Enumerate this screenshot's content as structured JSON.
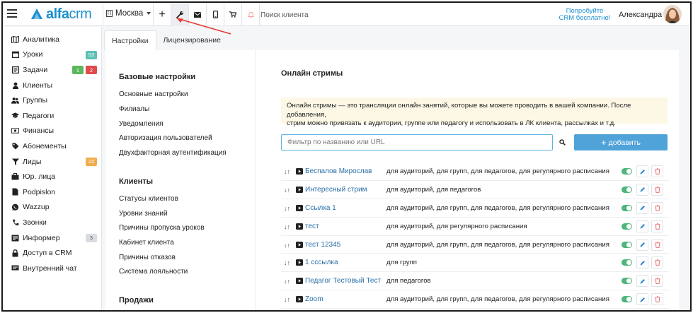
{
  "header": {
    "logo_main": "alfa",
    "logo_sub": "crm",
    "city": "Москва",
    "add_label": "+",
    "search_placeholder": "Поиск клиента",
    "try_line1": "Попробуйте",
    "try_line2": "CRM бесплатно!",
    "username": "Александра"
  },
  "sidebar": {
    "items": [
      {
        "label": "Аналитика",
        "icon": "map-icon"
      },
      {
        "label": "Уроки",
        "icon": "calendar-icon",
        "badges": [
          {
            "text": "53",
            "color": "teal"
          }
        ]
      },
      {
        "label": "Задачи",
        "icon": "tasks-icon",
        "badges": [
          {
            "text": "1",
            "color": "green"
          },
          {
            "text": "2",
            "color": "red"
          }
        ]
      },
      {
        "label": "Клиенты",
        "icon": "user-icon"
      },
      {
        "label": "Группы",
        "icon": "users-icon"
      },
      {
        "label": "Педагоги",
        "icon": "graduation-cap-icon"
      },
      {
        "label": "Финансы",
        "icon": "money-icon"
      },
      {
        "label": "Абонементы",
        "icon": "tag-icon"
      },
      {
        "label": "Лиды",
        "icon": "funnel-icon",
        "badges": [
          {
            "text": "22",
            "color": "orange"
          }
        ]
      },
      {
        "label": "Юр. лица",
        "icon": "briefcase-icon"
      },
      {
        "label": "Podpislon",
        "icon": "document-icon"
      },
      {
        "label": "Wazzup",
        "icon": "whatsapp-icon"
      },
      {
        "label": "Звонки",
        "icon": "phone-icon"
      },
      {
        "label": "Информер",
        "icon": "informer-icon",
        "badges": [
          {
            "text": "3",
            "color": "gray"
          }
        ]
      },
      {
        "label": "Доступ в CRM",
        "icon": "lock-icon"
      },
      {
        "label": "Внутренний чат",
        "icon": "chat-icon"
      }
    ]
  },
  "tabs": [
    {
      "label": "Настройки",
      "active": true
    },
    {
      "label": "Лицензирование",
      "active": false
    }
  ],
  "settings_nav": {
    "basic_title": "Базовые настройки",
    "basic_links": [
      "Основные настройки",
      "Филиалы",
      "Уведомления",
      "Авторизация пользователей",
      "Двухфакторная аутентификация"
    ],
    "clients_title": "Клиенты",
    "clients_links": [
      "Статусы клиентов",
      "Уровни знаний",
      "Причины пропуска уроков",
      "Кабинет клиента",
      "Причины отказов",
      "Система лояльности"
    ],
    "sales_title": "Продажи"
  },
  "panel": {
    "title": "Онлайн стримы",
    "info_line1": "Онлайн стримы — это трансляции онлайн занятий, которые вы можете проводить в вашей компании. После добавления,",
    "info_line2": "стрим можно привязать к аудитории, группе или педагогу и использовать в ЛК клиента, рассылках и т.д.",
    "filter_placeholder": "Фильтр по названию или URL",
    "add_label": "добавить",
    "add_icon": "+",
    "drag_icon": "↓↑"
  },
  "streams": [
    {
      "name": "Беспалов Мирослав",
      "scope": "для аудиторий, для групп, для педагогов, для регулярного расписания",
      "enabled": true
    },
    {
      "name": "Интересный стрим",
      "scope": "для аудиторий, для педагогов",
      "enabled": true
    },
    {
      "name": "Ссылка 1",
      "scope": "для аудиторий, для групп, для педагогов, для регулярного расписания",
      "enabled": true
    },
    {
      "name": "тест",
      "scope": "для аудиторий, для регулярного расписания",
      "enabled": true
    },
    {
      "name": "тест 12345",
      "scope": "для аудиторий, для групп, для педагогов, для регулярного расписания",
      "enabled": true
    },
    {
      "name": "1 сссылка",
      "scope": "для групп",
      "enabled": true
    },
    {
      "name": "Педагог Тестовый Тест",
      "scope": "для педагогов",
      "enabled": true
    },
    {
      "name": "Zoom",
      "scope": "для аудиторий, для групп, для педагогов, для регулярного расписания",
      "enabled": true
    }
  ],
  "colors": {
    "brand": "#1d8fcf",
    "add_button": "#4fa3d8",
    "toggle_on": "#4cb67c",
    "link": "#2a6fa8",
    "info_bg": "#fdf8e6",
    "annotation_arrow": "#e53935"
  }
}
